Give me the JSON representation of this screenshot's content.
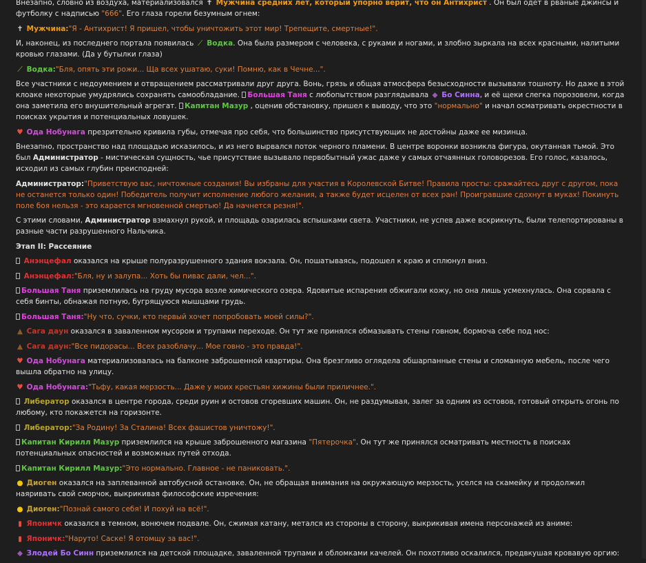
{
  "text": {
    "p1a": "Внезапно, словно из воздуха, материализовался ",
    "p1b": " Мужчина средних лет, который упорно верит, что он Антихрист",
    "p1c": " . Он был одет в рваные джинсы и футболку с надписью ",
    "p1d": "\"666\"",
    "p1e": ". Его глаза горели безумным огнем:",
    "p2a": " Мужчина:",
    "p2b": "\"Я - Антихрист! Я пришел, чтобы уничтожить этот мир! Трепещите, смертные!\".",
    "p3a": "И, наконец, из последнего портала появилась ",
    "p3b": " Водка",
    "p3c": ". Она была размером с человека, с руками и ногами, и злобно зыркала на всех красными, налитыми кровью глазами. (Да у бутылки глаза)",
    "p4a": " Водка:",
    "p4b": "\"Бля, опять эти рожи... Ща всех ушатаю, суки! Помню, как в Чечне...\".",
    "p5a": "Все участники с недоумением и отвращением рассматривали друг друга. Вонь, грязь и общая атмосфера безысходности вызывали тошноту. Но даже в этой клоаке некоторые умудрялись сохранять самообладание. ",
    "p5b": "Большая Таня",
    "p5c": " с любопытством разглядывала ",
    "p5d": " Бо Синна",
    "p5e": ", и её щеки слегка порозовели, когда она заметила его внушительный агрегат. ",
    "p5f": "Капитан Мазур",
    "p5g": " , оценив обстановку, пришел к выводу, что это ",
    "p5h": "\"нормально\"",
    "p5i": " и начал осматривать окрестности в поисках укрытия и потенциальных ловушек.",
    "p6a": " Ода Нобунага",
    "p6b": " презрительно кривила губы, отмечая про себя, что большинство присутствующих не достойны даже ее мизинца.",
    "p7a": "Внезапно, пространство над площадью исказилось, и из него вырвался поток черного пламени. В центре воронки возникла фигура, окутанная тьмой. Это был ",
    "p7b": "Администратор",
    "p7c": " - мистическая сущность, чье присутствие вызывало первобытный ужас даже у самых отчаянных головорезов. Его голос, казалось, исходил из самых глубин преисподней:",
    "p8a": "Администратор:",
    "p8b": "\"Приветствую вас, ничтожные создания! Вы избраны для участия в Королевской Битве! Правила просты: сражайтесь друг с другом, пока не останется только один! Победитель получит исполнение любого желания, а также будет исцелен от всех ран! Проигравшие сдохнут в муках! Покинуть поле боя нельзя - это карается мгновенной смертью! Да начнется резня!\".",
    "p9a": "С этими словами, ",
    "p9b": "Администратор",
    "p9c": " взмахнул рукой, и площадь озарилась вспышками света. Участники, не успев даже вскрикнуть, были телепортированы в разные части разрушенного Нальчика.",
    "heading": "Этап II: Рассеяние",
    "p10a": " Анэнцефал",
    "p10b": " оказался на крыше полуразрушенного здания вокзала. Он, пошатываясь, подошел к краю и сплюнул вниз.",
    "p11a": " Анэнцефал:",
    "p11b": "\"Бля, ну и залупа... Хоть бы пивас дали, чел...\".",
    "p12a": "Большая Таня",
    "p12b": " приземлилась на груду мусора возле химического озера. Ядовитые испарения обжигали кожу, но она лишь усмехнулась. Она сорвала с себя бинты, обнажая потную, бугрящуюся мышцами грудь.",
    "p13a": "Большая Таня:",
    "p13b": "\"Ну что, сучки, кто первый хочет попробовать моей силы?\".",
    "p14a": " Сага даун",
    "p14b": " оказался в заваленном мусором и трупами переходе. Он тут же принялся обмазывать стены говном, бормоча себе под нос:",
    "p15a": " Сага даун:",
    "p15b": "\"Все пидорасы... Всех разоблачу... Мое говно - это правда!\".",
    "p16a": " Ода Нобунага",
    "p16b": " материализовалась на балконе заброшенной квартиры. Она брезгливо оглядела обшарпанные стены и сломанную мебель, после чего вышла обратно на улицу.",
    "p17a": " Ода Нобунага:",
    "p17b": "\"Тьфу, какая мерзость... Даже у моих крестьян хижины были приличнее.\".",
    "p18a": " Либератор",
    "p18b": " оказался в центре города, среди руин и остовов сгоревших машин. Он, не раздумывая, залег за одним из остовов, готовый открыть огонь по любому, кто покажется на горизонте.",
    "p19a": " Либератор:",
    "p19b": "\"За Родину! За Сталина! Всех фашистов уничтожу!\".",
    "p20a": "Капитан Кирилл Мазур",
    "p20b": " приземлился на крыше заброшенного магазина ",
    "p20c": "\"Пятерочка\"",
    "p20d": ". Он тут же принялся осматривать местность в поисках потенциальных опасностей и возможных путей отхода.",
    "p21a": "Капитан Кирилл Мазур:",
    "p21b": "\"Это нормально. Главное - не паниковать.\".",
    "p22a": " Диоген",
    "p22b": " оказался на заплеванной автобусной остановке. Он, не обращая внимания на окружающую мерзость, уселся на скамейку и продолжил наяривать свой сморчок, выкрикивая философские изречения:",
    "p23a": " Диоген:",
    "p23b": "\"Познай самого себя! И похуй на всё!\".",
    "p24a": " Японичк",
    "p24b": " оказался в темном, вонючем подвале. Он, сжимая катану, метался из стороны в сторону, выкрикивая имена персонажей из аниме:",
    "p25a": " Японичк:",
    "p25b": "\"Наруто! Саске! Я отомщу за вас!\".",
    "p26a": " Злодей Бо Синн",
    "p26b": " приземлился на детской площадке, заваленной трупами и обломками качелей. Он похотливо оскалился, предвкушая кровавую оргию:"
  },
  "icons": {
    "cross": "✝",
    "bottle": "🍾",
    "eggplant": "🍆",
    "heart": "💔",
    "poop": "💩",
    "face": "😊",
    "mahjong": "🀄"
  },
  "colors": {
    "accent_orange": "#f39c12",
    "green": "#5ec640",
    "magenta": "#e040e0",
    "red": "#e23131",
    "background": "#1e1e1e"
  }
}
